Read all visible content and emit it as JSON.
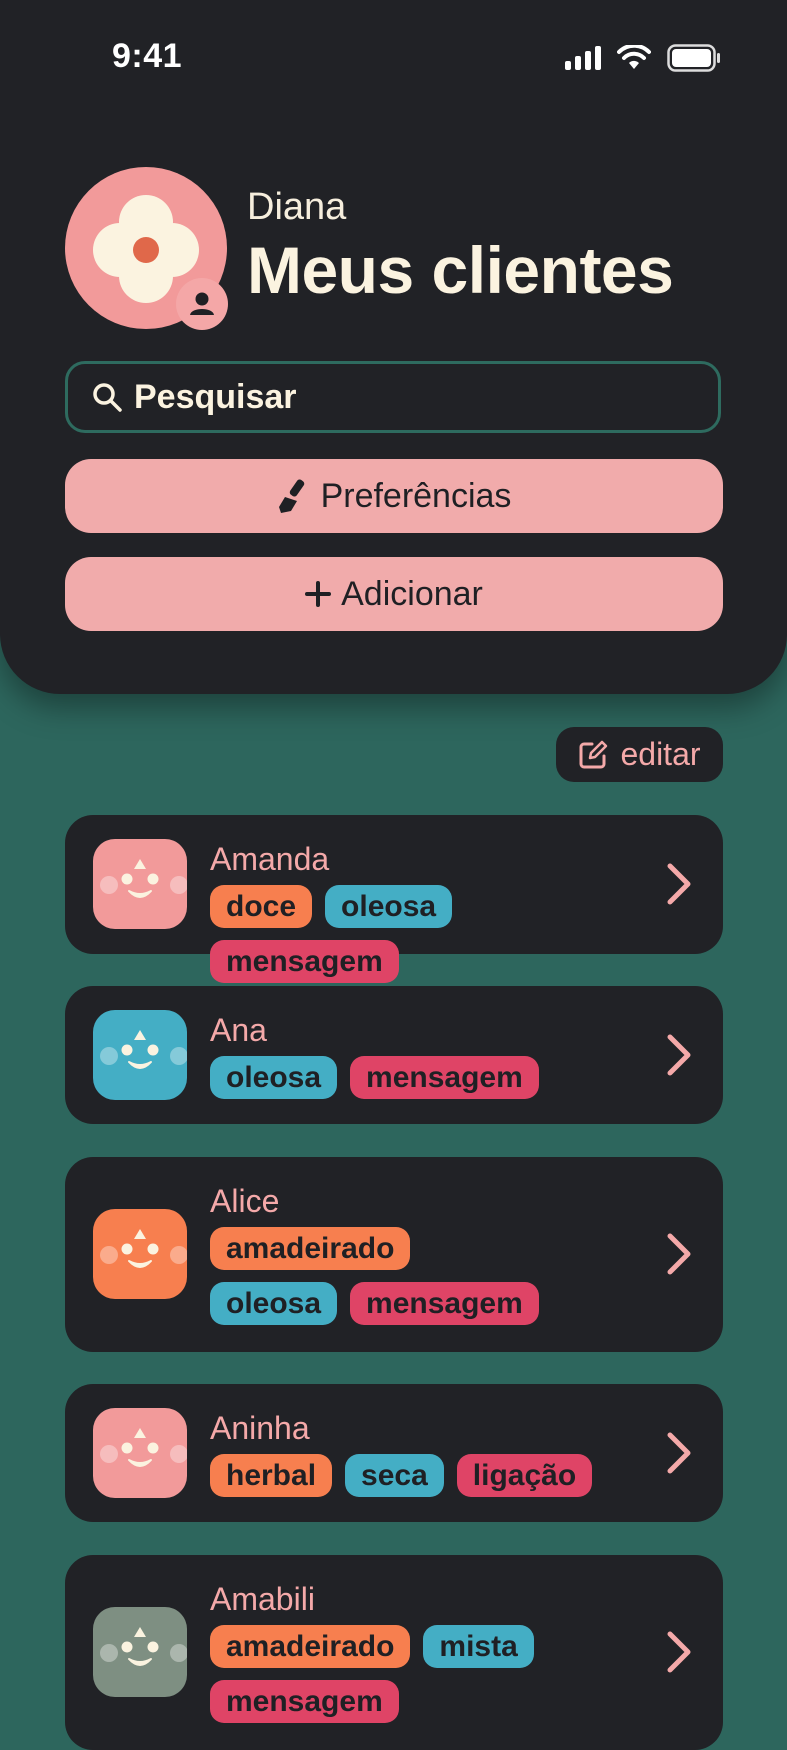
{
  "status_bar": {
    "time": "9:41"
  },
  "header": {
    "user_name": "Diana",
    "title": "Meus clientes",
    "search_placeholder": "Pesquisar",
    "preferences_label": "Preferências",
    "add_label": "Adicionar"
  },
  "edit_label": "editar",
  "colors": {
    "background_green": "#2d665d",
    "dark_panel": "#212226",
    "pink_button": "#f1abab",
    "tag_orange": "#f77f4f",
    "tag_blue": "#44aec5",
    "tag_red": "#df4466"
  },
  "clients": [
    {
      "name": "Amanda",
      "avatar_color": "#f29a9a",
      "tags": [
        {
          "label": "doce",
          "kind": "sweet"
        },
        {
          "label": "oleosa",
          "kind": "oily"
        },
        {
          "label": "mensagem",
          "kind": "msg"
        }
      ]
    },
    {
      "name": "Ana",
      "avatar_color": "#44aec5",
      "tags": [
        {
          "label": "oleosa",
          "kind": "oily"
        },
        {
          "label": "mensagem",
          "kind": "msg"
        }
      ]
    },
    {
      "name": "Alice",
      "avatar_color": "#f77f4f",
      "tags": [
        {
          "label": "amadeirado",
          "kind": "sweet"
        },
        {
          "label": "oleosa",
          "kind": "oily"
        },
        {
          "label": "mensagem",
          "kind": "msg"
        }
      ]
    },
    {
      "name": "Aninha",
      "avatar_color": "#f29a9a",
      "tags": [
        {
          "label": "herbal",
          "kind": "sweet"
        },
        {
          "label": "seca",
          "kind": "oily"
        },
        {
          "label": "ligação",
          "kind": "msg"
        }
      ]
    },
    {
      "name": "Amabili",
      "avatar_color": "#7e8f82",
      "tags": [
        {
          "label": "amadeirado",
          "kind": "sweet"
        },
        {
          "label": "mista",
          "kind": "oily"
        },
        {
          "label": "mensagem",
          "kind": "msg"
        }
      ]
    }
  ]
}
